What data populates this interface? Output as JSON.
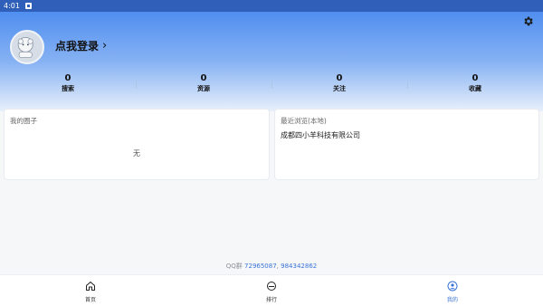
{
  "status_bar": {
    "time": "4:01",
    "icon": "notification-icon"
  },
  "header": {
    "login_text": "点我登录",
    "chevron": "›",
    "settings_icon": "gear-icon",
    "avatar_icon": "sheep-avatar-icon"
  },
  "stats": [
    {
      "value": "0",
      "label": "搜索"
    },
    {
      "value": "0",
      "label": "资源"
    },
    {
      "value": "0",
      "label": "关注"
    },
    {
      "value": "0",
      "label": "收藏"
    }
  ],
  "my_circles": {
    "title": "我的圈子",
    "empty_text": "无"
  },
  "recent": {
    "title": "最近浏览(本地)",
    "items": [
      "成都四小羊科技有限公司"
    ]
  },
  "footer": {
    "qq_label": "QQ群",
    "qq_numbers": [
      "72965087",
      "984342862"
    ],
    "separator": ","
  },
  "nav": [
    {
      "label": "首页",
      "icon": "home-icon",
      "active": false
    },
    {
      "label": "排行",
      "icon": "ranking-icon",
      "active": false
    },
    {
      "label": "我的",
      "icon": "profile-icon",
      "active": true
    }
  ],
  "colors": {
    "accent": "#3a73d8",
    "header_top": "#4f8ef0"
  }
}
